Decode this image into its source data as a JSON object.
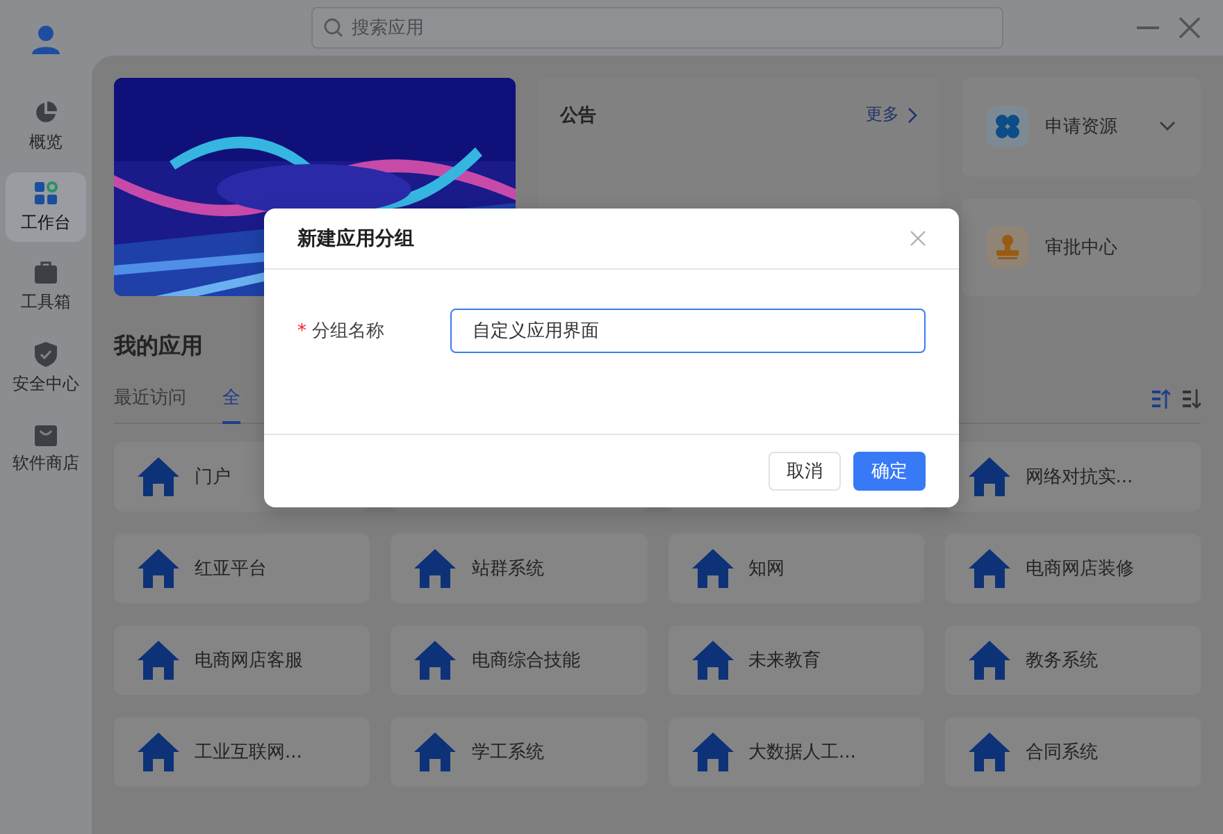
{
  "search": {
    "placeholder": "搜索应用"
  },
  "sidebar": {
    "items": [
      {
        "label": "概览",
        "kind": "overview",
        "selected": false
      },
      {
        "label": "工作台",
        "kind": "workbench",
        "selected": true
      },
      {
        "label": "工具箱",
        "kind": "toolbox",
        "selected": false
      },
      {
        "label": "安全中心",
        "kind": "security",
        "selected": false
      },
      {
        "label": "软件商店",
        "kind": "store",
        "selected": false
      }
    ]
  },
  "notice": {
    "title": "公告",
    "more": "更多"
  },
  "quick_actions": [
    {
      "label": "申请资源",
      "kind": "resources"
    },
    {
      "label": "审批中心",
      "kind": "approval"
    }
  ],
  "my_apps": {
    "title": "我的应用",
    "tabs": [
      {
        "label": "最近访问",
        "selected": false
      },
      {
        "label": "全",
        "selected": true
      }
    ],
    "apps": [
      {
        "label": "门户"
      },
      {
        "label": "网络对抗实..."
      },
      {
        "label": "红亚平台"
      },
      {
        "label": "站群系统"
      },
      {
        "label": "知网"
      },
      {
        "label": "电商网店装修"
      },
      {
        "label": "电商网店客服"
      },
      {
        "label": "电商综合技能"
      },
      {
        "label": "未来教育"
      },
      {
        "label": "教务系统"
      },
      {
        "label": "工业互联网..."
      },
      {
        "label": "学工系统"
      },
      {
        "label": "大数据人工..."
      },
      {
        "label": "合同系统"
      }
    ]
  },
  "dialog": {
    "title": "新建应用分组",
    "field": {
      "label": "分组名称",
      "required_mark": "*",
      "value": "自定义应用界面"
    },
    "buttons": [
      {
        "label": "取消",
        "kind": "secondary"
      },
      {
        "label": "确定",
        "kind": "primary"
      }
    ]
  }
}
